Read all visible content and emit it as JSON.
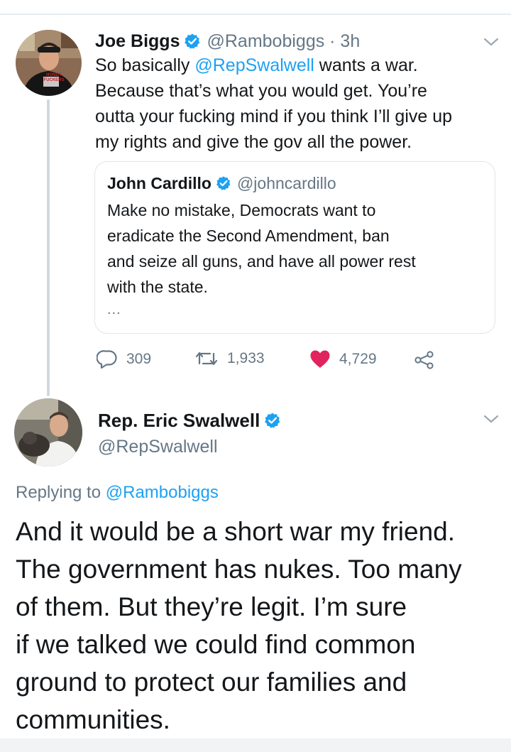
{
  "tweet1": {
    "name": "Joe Biggs",
    "handle": "@Rambobiggs · 3h",
    "body_lines": [
      {
        "pre": "So basically ",
        "mention": "@RepSwalwell",
        "post": " wants a war."
      },
      "Because that’s what you would get. You’re",
      "outta your fucking mind if you think I’ll give up",
      "my rights and give the gov all the power."
    ],
    "avatar_shirt_text": "HONDY FUCKERS"
  },
  "quote": {
    "name": "John Cardillo",
    "handle": "@johncardillo",
    "body_lines": [
      "Make no mistake, Democrats want to",
      "eradicate the Second Amendment, ban",
      "and seize all guns, and have all power rest",
      "with the state."
    ],
    "ellipsis": "..."
  },
  "actions": {
    "replies": "309",
    "retweets": "1,933",
    "likes": "4,729"
  },
  "tweet2": {
    "name": "Rep. Eric Swalwell",
    "handle": "@RepSwalwell",
    "replying_prefix": "Replying to ",
    "replying_to": "@Rambobiggs",
    "body_lines": [
      "And it would be a short war my friend.",
      "The government has nukes. Too many",
      "of them. But they’re legit. I’m sure",
      "if we talked we could find common",
      "ground to protect our families and",
      "communities."
    ]
  },
  "icons": {
    "verified": "verified-badge-icon",
    "reply": "comment-icon",
    "retweet": "retweet-icon",
    "like": "heart-icon",
    "share": "share-icon",
    "menu": "chevron-down-icon"
  },
  "colors": {
    "link": "#1da1f2",
    "secondary_text": "#657786",
    "like": "#e0245e",
    "verified": "#1da1f2"
  }
}
